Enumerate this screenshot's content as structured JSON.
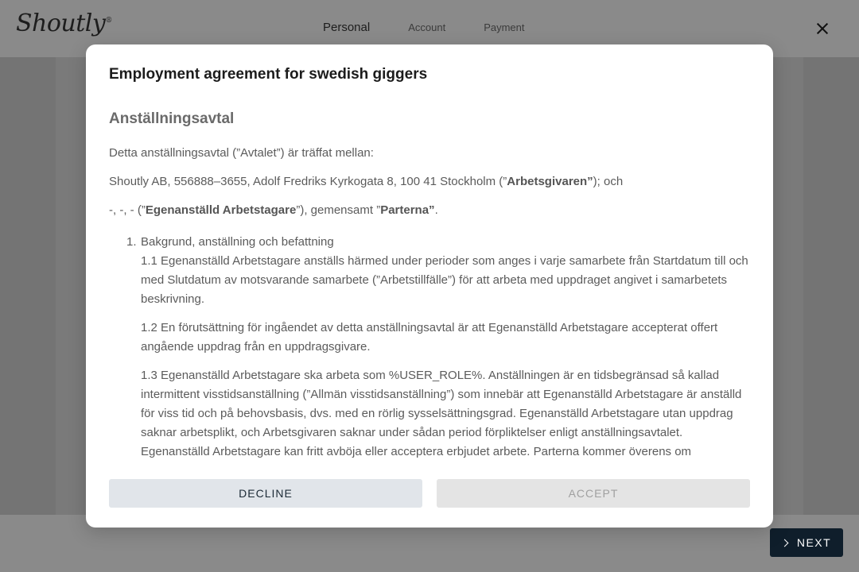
{
  "header": {
    "logo": "Shoutly",
    "logo_tm": "®",
    "steps": [
      "Personal",
      "Account",
      "Payment"
    ],
    "active_step": "Personal"
  },
  "footer": {
    "next_label": "NEXT"
  },
  "modal": {
    "title": "Employment agreement for swedish giggers",
    "heading": "Anställningsavtal",
    "intro": "Detta anställningsavtal (”Avtalet”) är träffat mellan:",
    "party1_prefix": "Shoutly AB, 556888–3655, Adolf Fredriks Kyrkogata 8, 100 41 Stockholm (”",
    "party1_bold": "Arbetsgivaren”",
    "party1_suffix": "); och",
    "party2_prefix": "-, -, - (”",
    "party2_bold": "Egenanställd Arbetstagare",
    "party2_mid": "”), gemensamt ”",
    "party2_bold2": "Parterna”",
    "party2_suffix": ".",
    "clause1_number": "1.",
    "clause1_title": "Bakgrund, anställning och befattning",
    "clause_1_1": "1.1 Egenanställd Arbetstagare anställs härmed under perioder som anges i varje samarbete från Startdatum till och med Slutdatum av motsvarande samarbete (”Arbetstillfälle”) för att arbeta med uppdraget angivet i samarbetets beskrivning.",
    "clause_1_2": "1.2 En förutsättning för ingåendet av detta anställningsavtal är att Egenanställd Arbetstagare accepterat offert angående uppdrag från en uppdragsgivare.",
    "clause_1_3": "1.3 Egenanställd Arbetstagare ska arbeta som %USER_ROLE%. Anställningen är en tidsbegränsad så kallad intermittent visstidsanställning (”Allmän visstidsanställning”) som innebär att Egenanställd Arbetstagare är anställd för viss tid och på behovsbasis, dvs. med en rörlig sysselsättningsgrad. Egenanställd Arbetstagare utan uppdrag saknar arbetsplikt, och Arbetsgivaren saknar under sådan period förpliktelser enligt anställningsavtalet. Egenanställd Arbetstagare kan fritt avböja eller acceptera erbjudet arbete. Parterna kommer överens om",
    "decline_label": "DECLINE",
    "accept_label": "ACCEPT"
  }
}
